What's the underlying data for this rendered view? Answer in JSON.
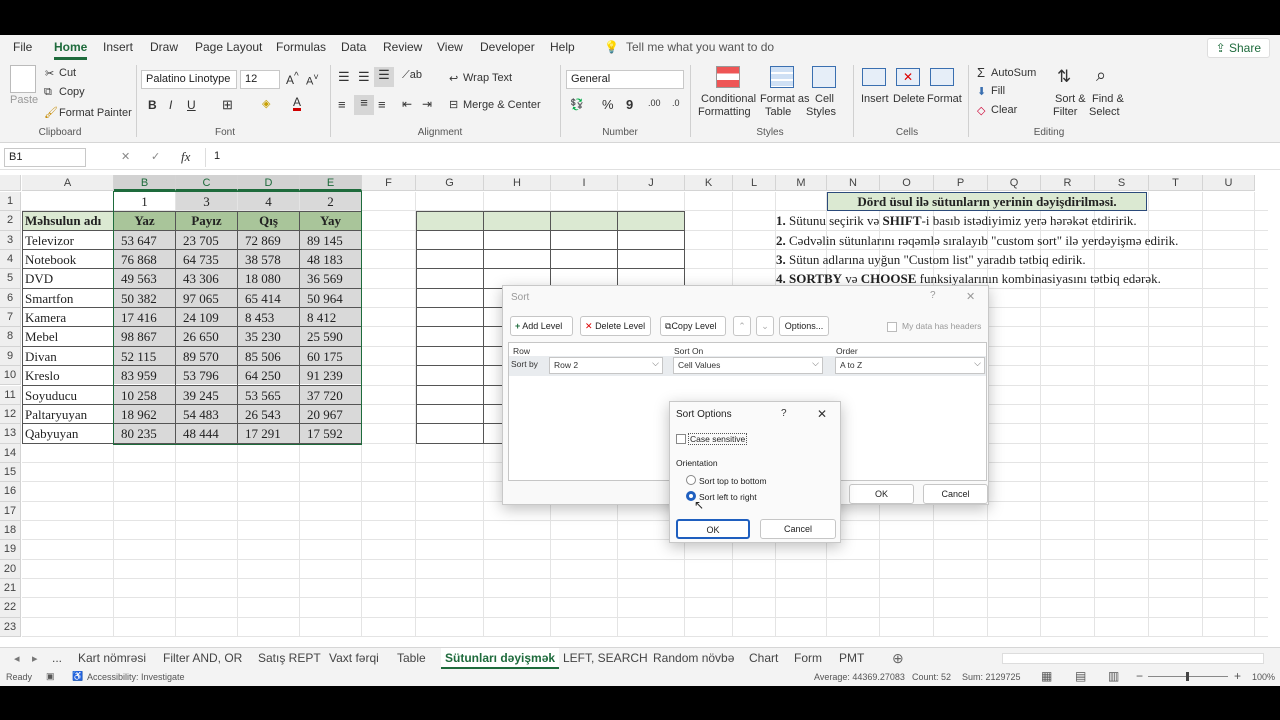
{
  "menu": [
    "File",
    "Home",
    "Insert",
    "Draw",
    "Page Layout",
    "Formulas",
    "Data",
    "Review",
    "View",
    "Developer",
    "Help"
  ],
  "tell_me": "Tell me what you want to do",
  "share_label": "Share",
  "ribbon": {
    "clipboard": {
      "paste": "Paste",
      "cut": "Cut",
      "copy": "Copy",
      "format_painter": "Format Painter",
      "label": "Clipboard"
    },
    "font": {
      "name": "Palatino Linotype",
      "size": "12",
      "label": "Font"
    },
    "alignment": {
      "wrap_text": "Wrap Text",
      "merge_center": "Merge & Center",
      "label": "Alignment"
    },
    "number": {
      "format": "General",
      "label": "Number"
    },
    "styles": {
      "conditional": "Conditional",
      "formatting": "Formatting",
      "format_as": "Format as",
      "table": "Table",
      "cell": "Cell",
      "cell_styles": "Styles",
      "label": "Styles"
    },
    "cells": {
      "insert": "Insert",
      "delete": "Delete",
      "format": "Format",
      "label": "Cells"
    },
    "editing": {
      "autosum": "AutoSum",
      "fill": "Fill",
      "clear": "Clear",
      "sort": "Sort &",
      "filter": "Filter",
      "find": "Find &",
      "select": "Select",
      "label": "Editing"
    }
  },
  "formula_bar": {
    "name_box": "B1",
    "fx": "fx",
    "value": "1"
  },
  "columns": [
    "A",
    "B",
    "C",
    "D",
    "E",
    "F",
    "G",
    "H",
    "I",
    "J",
    "K",
    "L",
    "M",
    "N",
    "O",
    "P",
    "Q",
    "R",
    "S",
    "T",
    "U"
  ],
  "rows": [
    "1",
    "2",
    "3",
    "4",
    "5",
    "6",
    "7",
    "8",
    "9",
    "10",
    "11",
    "12",
    "13",
    "14",
    "15",
    "16",
    "17",
    "18",
    "19",
    "20",
    "21",
    "22",
    "23"
  ],
  "table": {
    "order_row": [
      "1",
      "3",
      "4",
      "2"
    ],
    "headers": [
      "Məhsulun adı",
      "Yaz",
      "Payız",
      "Qış",
      "Yay"
    ],
    "data": [
      [
        "Televizor",
        "53 647",
        "23 705",
        "72 869",
        "89 145"
      ],
      [
        "Notebook",
        "76 868",
        "64 735",
        "38 578",
        "48 183"
      ],
      [
        "DVD",
        "49 563",
        "43 306",
        "18 080",
        "36 569"
      ],
      [
        "Smartfon",
        "50 382",
        "97 065",
        "65 414",
        "50 964"
      ],
      [
        "Kamera",
        "17 416",
        "24 109",
        "8 453",
        "8 412"
      ],
      [
        "Mebel",
        "98 867",
        "26 650",
        "35 230",
        "25 590"
      ],
      [
        "Divan",
        "52 115",
        "89 570",
        "85 506",
        "60 175"
      ],
      [
        "Kreslo",
        "83 959",
        "53 796",
        "64 250",
        "91 239"
      ],
      [
        "Soyuducu",
        "10 258",
        "39 245",
        "53 565",
        "37 720"
      ],
      [
        "Paltaryuyan",
        "18 962",
        "54 483",
        "26 543",
        "20 967"
      ],
      [
        "Qabyuyan",
        "80 235",
        "48 444",
        "17 291",
        "17 592"
      ]
    ]
  },
  "notes": {
    "title": "Dörd üsul ilə sütunların yerinin dəyişdirilməsi.",
    "items": [
      {
        "num": "1.",
        "text_a": " Sütunu seçirik və ",
        "bold": "SHIFT",
        "text_b": "-i basıb istədiyimiz yerə hərəkət etdiririk."
      },
      {
        "num": "2.",
        "text_a": " Cədvəlin sütunlarını rəqəmlə sıralayıb \"custom sort\" ilə yerdəyişmə edirik.",
        "bold": "",
        "text_b": ""
      },
      {
        "num": "3.",
        "text_a": " Sütun adlarına uyğun \"Custom list\" yaradıb tətbiq edirik.",
        "bold": "",
        "text_b": ""
      },
      {
        "num": "4.",
        "text_a": " ",
        "bold": "SORTBY",
        "text_b": " və ",
        "bold2": "CHOOSE",
        "text_c": " funksiyalarının kombinasiyasını tətbiq edərək."
      }
    ]
  },
  "sort_dialog": {
    "title": "Sort",
    "help": "?",
    "close": "✕",
    "add_level": "Add Level",
    "delete_level": "Delete Level",
    "copy_level": "Copy Level",
    "options": "Options...",
    "my_data_headers": "My data has headers",
    "col_row": "Row",
    "col_sort_on": "Sort On",
    "col_order": "Order",
    "sort_by": "Sort by",
    "row_value": "Row 2",
    "sort_on_value": "Cell Values",
    "order_value": "A to Z",
    "ok": "OK",
    "cancel": "Cancel"
  },
  "options_dialog": {
    "title": "Sort Options",
    "help": "?",
    "close": "✕",
    "case_sensitive": "Case sensitive",
    "orientation": "Orientation",
    "top_bottom": "Sort top to bottom",
    "left_right": "Sort left to right",
    "selected": "left_right",
    "ok": "OK",
    "cancel": "Cancel"
  },
  "sheet_tabs": [
    "...",
    "Kart nömrəsi",
    "Filter AND, OR",
    "Satış REPT",
    "Vaxt fərqi",
    "Table",
    "Sütunları dəyişmək",
    "LEFT, SEARCH",
    "Random növbə",
    "Chart",
    "Form",
    "PMT"
  ],
  "active_tab": "Sütunları dəyişmək",
  "status": {
    "ready": "Ready",
    "accessibility": "Accessibility: Investigate",
    "average": "Average: 44369.27083",
    "count": "Count: 52",
    "sum": "Sum: 2129725",
    "zoom": "100%"
  }
}
